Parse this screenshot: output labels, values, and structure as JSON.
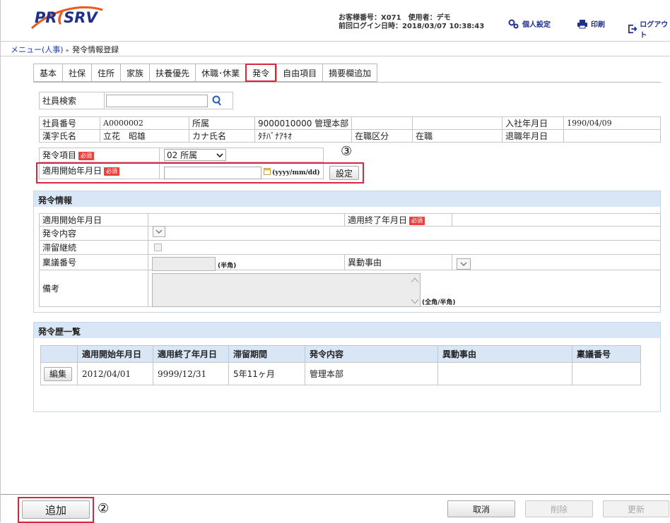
{
  "header": {
    "logo": {
      "pre": "PR",
      "accent": "(",
      "post": "SRV"
    },
    "account_line1": "お客様番号：X071　使用者：デモ",
    "account_line2": "前回ログイン日時：2018/03/07 10:38:43",
    "personal_settings": "個人設定",
    "print": "印刷",
    "logout": "ログアウト"
  },
  "breadcrumb": {
    "menu": "メニュー(人事)",
    "current": "発令情報登録"
  },
  "tabs": [
    "基本",
    "社保",
    "住所",
    "家族",
    "扶養優先",
    "休職･休業",
    "発令",
    "自由項目",
    "摘要欄追加"
  ],
  "search": {
    "label": "社員検索",
    "value": ""
  },
  "employee": {
    "no_label": "社員番号",
    "no": "A0000002",
    "dept_label": "所属",
    "dept": "9000010000 管理本部",
    "hire_label": "入社年月日",
    "hire": "1990/04/09",
    "name_label": "漢字氏名",
    "name": "立花　昭雄",
    "kana_label": "カナ氏名",
    "kana": "ﾀﾁﾊﾞﾅｱｷｵ",
    "status_label": "在職区分",
    "status": "在職",
    "retire_label": "退職年月日",
    "retire": ""
  },
  "order_form": {
    "item_label": "発令項目",
    "required": "必須",
    "item_value": "02 所属",
    "start_label": "適用開始年月日",
    "start_value": "",
    "date_hint": "(yyyy/mm/dd)",
    "set_button": "設定"
  },
  "order_info": {
    "title": "発令情報",
    "start_label": "適用開始年月日",
    "end_label": "適用終了年月日",
    "content_label": "発令内容",
    "stay_label": "滞留継続",
    "proposal_label": "稟議番号",
    "halfwidth": "(半角)",
    "reason_label": "異動事由",
    "remarks_label": "備考",
    "remarks_hint": "(全角/半角)"
  },
  "history": {
    "title": "発令歴一覧",
    "columns": [
      "適用開始年月日",
      "適用終了年月日",
      "滞留期間",
      "発令内容",
      "異動事由",
      "稟議番号"
    ],
    "rows": [
      {
        "edit": "編集",
        "start": "2012/04/01",
        "end": "9999/12/31",
        "period": "5年11ヶ月",
        "content": "管理本部",
        "reason": "",
        "proposal": ""
      }
    ]
  },
  "footer": {
    "add": "追加",
    "cancel": "取消",
    "delete": "削除",
    "update": "更新"
  },
  "annotations": {
    "num2": "②",
    "num3": "③"
  },
  "colors": {
    "accent_red": "#d7263d",
    "brand_blue": "#1e2f8c",
    "logo_orange": "#e85b1d",
    "section_blue": "#d9e6f6"
  }
}
